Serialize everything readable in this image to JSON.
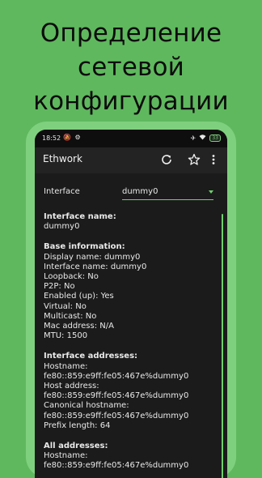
{
  "promo": {
    "lines": [
      "Определение",
      "сетевой",
      "конфигурации"
    ]
  },
  "status_bar": {
    "time": "18:52",
    "battery": "33"
  },
  "app_bar": {
    "title": "Ethwork"
  },
  "interface_selector": {
    "label": "Interface",
    "value": "dummy0"
  },
  "interface_name": {
    "title": "Interface name:",
    "value": "dummy0"
  },
  "base_info": {
    "title": "Base information:",
    "lines": [
      "Display name: dummy0",
      "Interface name: dummy0",
      "Loopback: No",
      "P2P: No",
      "Enabled (up): Yes",
      "Virtual: No",
      "Multicast: No",
      "Mac address: N/A",
      "MTU: 1500"
    ]
  },
  "interface_addresses": {
    "title": "Interface addresses:",
    "lines": [
      "Hostname:",
      "fe80::859:e9ff:fe05:467e%dummy0",
      "Host address:",
      "fe80::859:e9ff:fe05:467e%dummy0",
      "Canonical hostname:",
      "fe80::859:e9ff:fe05:467e%dummy0",
      "Prefix length: 64"
    ]
  },
  "all_addresses": {
    "title": "All addresses:",
    "lines": [
      "Hostname:",
      "fe80::859:e9ff:fe05:467e%dummy0"
    ]
  },
  "colors": {
    "accent": "#6fd06e",
    "background": "#5fb85e",
    "surface": "#1b1b1b"
  }
}
